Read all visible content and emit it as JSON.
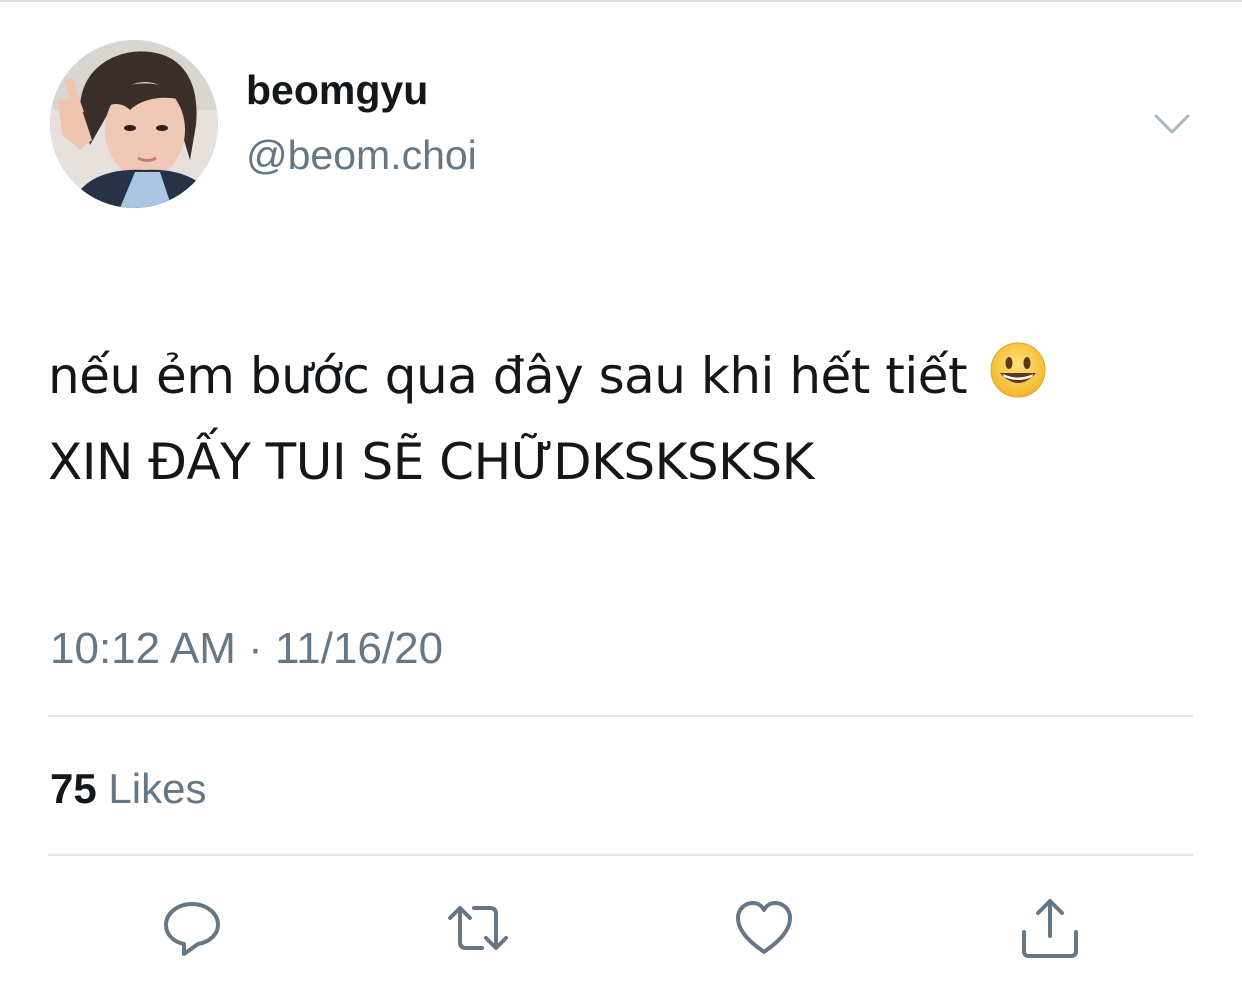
{
  "tweet": {
    "author": {
      "display_name": "beomgyu",
      "handle": "@beom.choi",
      "avatar_icon": "profile-photo"
    },
    "text_lines": [
      "nếu ẻm bước qua đây sau khi hết tiết",
      "XIN ĐẤY TUI SẼ CHỮDKSKSKSK"
    ],
    "emoji": "grinning-face",
    "time": "10:12 AM",
    "separator": "·",
    "date": "11/16/20",
    "likes": {
      "count": "75",
      "label": "Likes"
    },
    "actions": [
      {
        "name": "reply",
        "icon": "speech-bubble-icon"
      },
      {
        "name": "retweet",
        "icon": "retweet-icon"
      },
      {
        "name": "like",
        "icon": "heart-icon"
      },
      {
        "name": "share",
        "icon": "share-icon"
      }
    ]
  },
  "colors": {
    "primary_text": "#14171a",
    "secondary_text": "#657786",
    "divider": "#e1e8ed",
    "icon": "#657786",
    "emoji_yellow": "#f7c53e"
  }
}
